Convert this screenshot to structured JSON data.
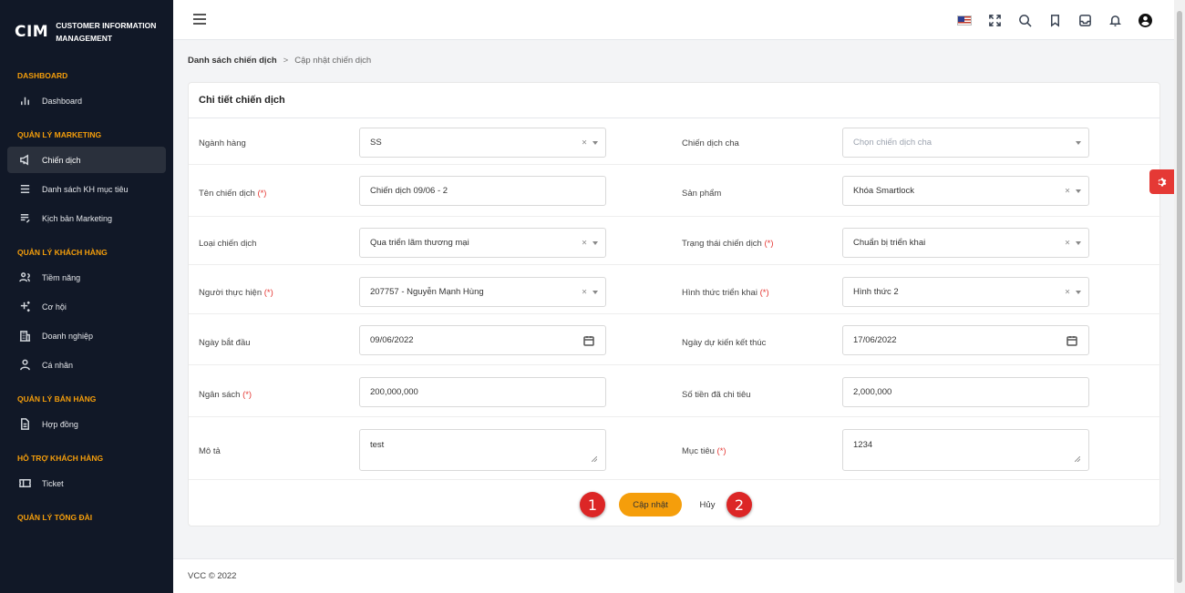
{
  "brand": {
    "logo": "CIM",
    "line1": "CUSTOMER INFORMATION",
    "line2": "MANAGEMENT"
  },
  "sidebar": {
    "sections": [
      {
        "title": "DASHBOARD",
        "items": [
          {
            "label": "Dashboard",
            "icon": "bar-chart-icon"
          }
        ]
      },
      {
        "title": "QUẢN LÝ MARKETING",
        "items": [
          {
            "label": "Chiến dịch",
            "icon": "megaphone-icon",
            "active": true
          },
          {
            "label": "Danh sách KH mục tiêu",
            "icon": "list-icon"
          },
          {
            "label": "Kịch bản Marketing",
            "icon": "script-icon"
          }
        ]
      },
      {
        "title": "QUẢN LÝ KHÁCH HÀNG",
        "items": [
          {
            "label": "Tiềm năng",
            "icon": "users-icon"
          },
          {
            "label": "Cơ hội",
            "icon": "sparkle-icon"
          },
          {
            "label": "Doanh nghiệp",
            "icon": "building-icon"
          },
          {
            "label": "Cá nhân",
            "icon": "user-icon"
          }
        ]
      },
      {
        "title": "QUẢN LÝ BÁN HÀNG",
        "items": [
          {
            "label": "Hợp đồng",
            "icon": "document-icon"
          }
        ]
      },
      {
        "title": "HỖ TRỢ KHÁCH HÀNG",
        "items": [
          {
            "label": "Ticket",
            "icon": "ticket-icon"
          }
        ]
      },
      {
        "title": "QUẢN LÝ TỔNG ĐÀI",
        "items": []
      }
    ]
  },
  "header": {
    "icons": [
      "us-flag-icon",
      "fullscreen-icon",
      "search-icon",
      "bookmark-icon",
      "inbox-icon",
      "bell-icon",
      "account-icon"
    ]
  },
  "breadcrumb": {
    "parent": "Danh sách chiến dịch",
    "current": "Cập nhật chiến dịch"
  },
  "form": {
    "title": "Chi tiết chiến dịch",
    "industry": {
      "label": "Ngành hàng",
      "value": "SS"
    },
    "parent_campaign": {
      "label": "Chiến dịch cha",
      "placeholder": "Chọn chiến dịch cha"
    },
    "campaign_name": {
      "label": "Tên chiến dịch",
      "required": "(*)",
      "value": "Chiến dịch 09/06 - 2"
    },
    "product": {
      "label": "Sản phẩm",
      "value": "Khóa Smartlock"
    },
    "campaign_type": {
      "label": "Loại chiến dịch",
      "value": "Qua triển lãm thương mại"
    },
    "campaign_status": {
      "label": "Trạng thái chiến dịch",
      "required": "(*)",
      "value": "Chuẩn bị triển khai"
    },
    "assignee": {
      "label": "Người thực hiện",
      "required": "(*)",
      "value": "207757 - Nguyễn Mạnh Hùng"
    },
    "deploy_form": {
      "label": "Hình thức triển khai",
      "required": "(*)",
      "value": "Hình thức 2"
    },
    "start_date": {
      "label": "Ngày bắt đầu",
      "value": "09/06/2022"
    },
    "end_date": {
      "label": "Ngày dự kiến kết thúc",
      "value": "17/06/2022"
    },
    "budget": {
      "label": "Ngân sách",
      "required": "(*)",
      "value": "200,000,000"
    },
    "spent": {
      "label": "Số tiền đã chi tiêu",
      "value": "2,000,000"
    },
    "description": {
      "label": "Mô tả",
      "value": "test"
    },
    "objective": {
      "label": "Mục tiêu",
      "required": "(*)",
      "value": "1234"
    },
    "update_button": "Cập nhật",
    "cancel_button": "Hủy",
    "clear_glyph": "×"
  },
  "markers": {
    "m1": "1",
    "m2": "2"
  },
  "footer": {
    "text": "VCC © 2022"
  },
  "colors": {
    "sidebar_bg": "#111827",
    "accent": "#f59e0b",
    "required": "#e53935",
    "marker": "#dc2626"
  }
}
